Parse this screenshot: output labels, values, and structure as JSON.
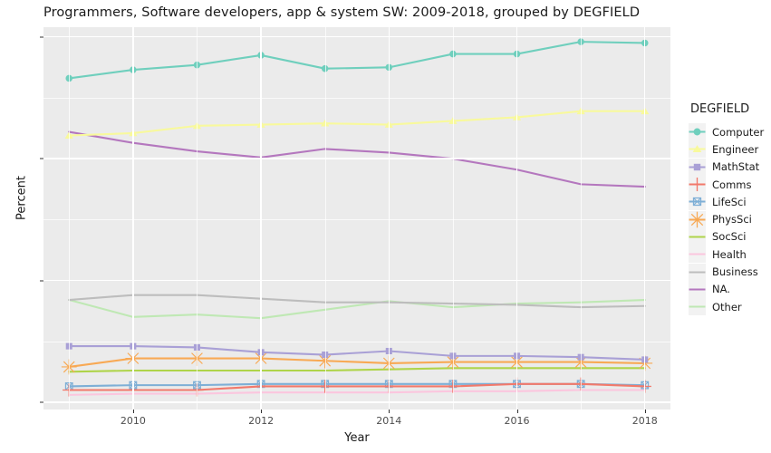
{
  "chart_data": {
    "type": "line",
    "title": "Programmers, Software developers, app & system SW: 2009-2018, grouped by DEGFIELD",
    "xlabel": "Year",
    "ylabel": "Percent",
    "legend_title": "DEGFIELD",
    "legend_position": "right",
    "grid": true,
    "x": [
      2009,
      2010,
      2011,
      2012,
      2013,
      2014,
      2015,
      2016,
      2017,
      2018
    ],
    "xlim": [
      2008.6,
      2018.4
    ],
    "ylim": [
      -0.6,
      30.8
    ],
    "x_ticks": [
      2010,
      2012,
      2014,
      2016,
      2018
    ],
    "y_ticks": [
      0,
      10,
      20,
      30
    ],
    "series": [
      {
        "name": "Computer",
        "color": "#6FCFBD",
        "marker": "circle",
        "values": [
          26.6,
          27.3,
          27.7,
          28.5,
          27.4,
          27.5,
          28.6,
          28.6,
          29.6,
          29.5
        ]
      },
      {
        "name": "Engineer",
        "color": "#F8F99C",
        "marker": "triangle",
        "values": [
          21.9,
          22.1,
          22.7,
          22.8,
          22.9,
          22.8,
          23.1,
          23.4,
          23.9,
          23.9
        ]
      },
      {
        "name": "MathStat",
        "color": "#A9A0D6",
        "marker": "square",
        "values": [
          4.6,
          4.6,
          4.5,
          4.1,
          3.9,
          4.2,
          3.8,
          3.8,
          3.7,
          3.5
        ]
      },
      {
        "name": "Comms",
        "color": "#F2796B",
        "marker": "plus",
        "values": [
          1.0,
          1.0,
          1.0,
          1.3,
          1.3,
          1.3,
          1.3,
          1.5,
          1.5,
          1.3
        ]
      },
      {
        "name": "LifeSci",
        "color": "#7EAFD6",
        "marker": "square-x",
        "values": [
          1.3,
          1.4,
          1.4,
          1.5,
          1.5,
          1.5,
          1.5,
          1.5,
          1.5,
          1.4
        ]
      },
      {
        "name": "PhysSci",
        "color": "#F8A954",
        "marker": "asterisk",
        "values": [
          2.9,
          3.6,
          3.6,
          3.6,
          3.4,
          3.2,
          3.3,
          3.3,
          3.3,
          3.2
        ]
      },
      {
        "name": "SocSci",
        "color": "#AFD44A",
        "marker": "none",
        "values": [
          2.5,
          2.6,
          2.6,
          2.6,
          2.6,
          2.7,
          2.8,
          2.8,
          2.8,
          2.8
        ]
      },
      {
        "name": "Health",
        "color": "#FBC6DE",
        "marker": "none",
        "values": [
          0.6,
          0.7,
          0.7,
          0.8,
          0.8,
          0.8,
          0.9,
          0.9,
          1.0,
          1.0
        ]
      },
      {
        "name": "Business",
        "color": "#BDBDBD",
        "marker": "none",
        "values": [
          8.4,
          8.8,
          8.8,
          8.5,
          8.2,
          8.2,
          8.1,
          8.0,
          7.8,
          7.9
        ]
      },
      {
        "name": "NA.",
        "color": "#B477BE",
        "marker": "none",
        "values": [
          22.2,
          21.3,
          20.6,
          20.1,
          20.8,
          20.5,
          20.0,
          19.1,
          17.9,
          17.7
        ]
      },
      {
        "name": "Other",
        "color": "#BFE8B4",
        "marker": "none",
        "values": [
          8.4,
          7.0,
          7.2,
          6.9,
          7.6,
          8.3,
          7.8,
          8.1,
          8.2,
          8.4
        ]
      }
    ]
  }
}
